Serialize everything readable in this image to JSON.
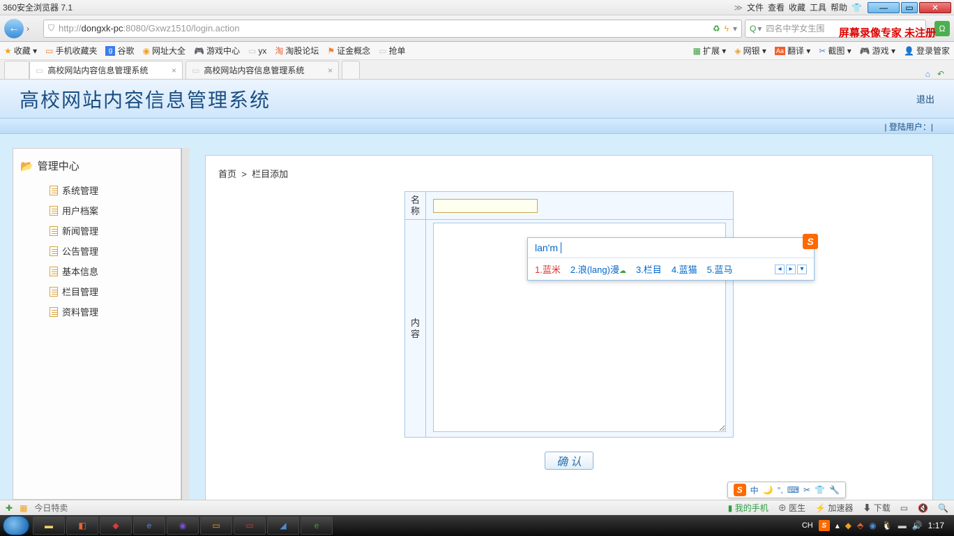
{
  "browser": {
    "title": "360安全浏览器 7.1",
    "menus": [
      "文件",
      "查看",
      "收藏",
      "工具",
      "帮助"
    ],
    "url_prefix": "http://",
    "url_host": "dongxk-pc",
    "url_rest": ":8080/Gxwz1510/login.action",
    "search_hint": "四名中学女生围",
    "watermark": "屏幕录像专家 未注册"
  },
  "bookmarks": {
    "left": [
      "收藏 ▾",
      "手机收藏夹",
      "谷歌",
      "网址大全",
      "游戏中心",
      "yx",
      "淘股论坛",
      "证金概念",
      "抢单"
    ],
    "right": [
      "扩展 ▾",
      "网银 ▾",
      "翻译 ▾",
      "截图 ▾",
      "游戏 ▾",
      "登录管家"
    ]
  },
  "tabs": {
    "t1": "高校网站内容信息管理系统",
    "t2": "高校网站内容信息管理系统"
  },
  "app": {
    "title": "高校网站内容信息管理系统",
    "logout": "退出",
    "login_strip": "| 登陆用户：|"
  },
  "sidebar": {
    "title": "管理中心",
    "items": [
      "系统管理",
      "用户档案",
      "新闻管理",
      "公告管理",
      "基本信息",
      "栏目管理",
      "资料管理"
    ]
  },
  "breadcrumb": {
    "home": "首页",
    "current": "栏目添加"
  },
  "form": {
    "name_label": "名称",
    "content_label": "内容",
    "name_value": "",
    "confirm": "确 认"
  },
  "ime": {
    "input": "lan'm",
    "candidates": [
      {
        "n": "1.",
        "t": "蓝米"
      },
      {
        "n": "2.",
        "t": "浪(lang)漫"
      },
      {
        "n": "3.",
        "t": "栏目"
      },
      {
        "n": "4.",
        "t": "蓝猫"
      },
      {
        "n": "5.",
        "t": "蓝马"
      }
    ]
  },
  "ime_tray": {
    "items": [
      "中",
      "🌙",
      "°,",
      "⌨",
      "✂",
      "👕",
      "🔧"
    ]
  },
  "status": {
    "left": [
      "今日特卖"
    ],
    "right": [
      "我的手机",
      "医生",
      "加速器",
      "下载",
      "",
      "",
      ""
    ]
  },
  "taskbar": {
    "lang": "CH",
    "time": "1:17"
  }
}
